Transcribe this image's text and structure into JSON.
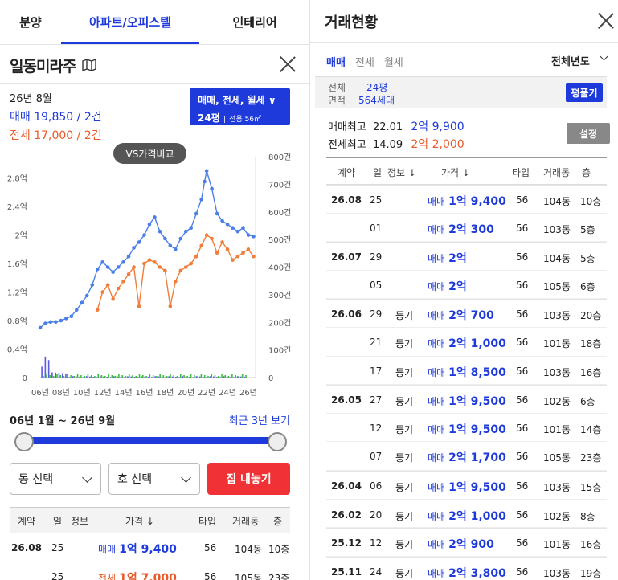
{
  "tabs": [
    "분양",
    "아파트/오피스텔",
    "인테리어"
  ],
  "complex": {
    "name": "일동미라주",
    "icon": "map-icon"
  },
  "summary": {
    "month": "26년 8월",
    "sale": "매매 19,850 / 2건",
    "jeonse": "전세 17,000 / 2건"
  },
  "filter": {
    "types": "매매, 전세, 월세",
    "size": "24평",
    "exclusive": "전용 56㎡"
  },
  "vs_button": "VS가격비교",
  "chart_data": {
    "type": "line",
    "x_ticks": [
      "06년",
      "08년",
      "10년",
      "12년",
      "14년",
      "16년",
      "18년",
      "20년",
      "22년",
      "24년",
      "26년"
    ],
    "y_left_ticks": [
      "0",
      "0.4억",
      "0.8억",
      "1.2억",
      "1.6억",
      "2억",
      "2.4억",
      "2.8억"
    ],
    "y_right_ticks": [
      "0",
      "100건",
      "200건",
      "300건",
      "400건",
      "500건",
      "600건",
      "700건",
      "800건"
    ],
    "ylim_left": [
      0,
      3.1
    ],
    "ylim_right": [
      0,
      800
    ],
    "colors": {
      "sale": "#4a7fe8",
      "jeonse": "#f07d3a",
      "volume_sale": "#5a5ae6",
      "volume_jeonse": "#3cc03c"
    },
    "series": [
      {
        "key": "sale",
        "x": [
          2006.0,
          2006.5,
          2007.0,
          2007.5,
          2008.0,
          2008.5,
          2009.0,
          2009.5,
          2010.0,
          2010.5,
          2011.0,
          2011.5,
          2012.0,
          2012.5,
          2013.0,
          2013.5,
          2014.0,
          2014.5,
          2015.0,
          2015.5,
          2016.0,
          2016.5,
          2017.0,
          2017.5,
          2018.0,
          2018.5,
          2019.0,
          2019.5,
          2020.0,
          2020.5,
          2021.0,
          2021.5,
          2021.8,
          2022.0,
          2022.5,
          2023.0,
          2023.5,
          2024.0,
          2024.5,
          2025.0,
          2025.5,
          2026.0,
          2026.5
        ],
        "y": [
          0.7,
          0.76,
          0.78,
          0.78,
          0.8,
          0.83,
          0.86,
          0.95,
          1.05,
          1.15,
          1.3,
          1.52,
          1.62,
          1.55,
          1.48,
          1.55,
          1.62,
          1.7,
          1.82,
          1.9,
          2.0,
          2.15,
          2.25,
          2.05,
          1.95,
          1.85,
          1.8,
          1.95,
          2.05,
          2.1,
          2.3,
          2.5,
          2.75,
          2.9,
          2.65,
          2.3,
          2.2,
          2.15,
          2.1,
          2.05,
          2.1,
          2.0,
          1.98
        ]
      },
      {
        "key": "jeonse",
        "x": [
          2011.5,
          2012.0,
          2012.5,
          2013.0,
          2013.5,
          2014.0,
          2014.5,
          2015.0,
          2015.5,
          2016.0,
          2016.5,
          2017.0,
          2017.5,
          2018.0,
          2018.5,
          2019.0,
          2019.5,
          2020.0,
          2020.5,
          2021.0,
          2021.5,
          2022.0,
          2022.5,
          2023.0,
          2023.5,
          2024.0,
          2024.5,
          2025.0,
          2025.5,
          2026.0,
          2026.5
        ],
        "y": [
          0.95,
          1.2,
          1.3,
          1.1,
          1.25,
          1.35,
          1.45,
          1.55,
          1.0,
          1.6,
          1.65,
          1.62,
          1.55,
          1.5,
          1.0,
          1.35,
          1.5,
          1.55,
          1.6,
          1.7,
          1.85,
          2.0,
          1.95,
          1.75,
          1.9,
          1.8,
          1.65,
          1.7,
          1.75,
          1.8,
          1.7
        ]
      }
    ]
  },
  "range": {
    "label": "06년 1월 ~ 26년 9월",
    "recent": "최근 3년 보기"
  },
  "selects": {
    "dong": "동 선택",
    "ho": "호 선택"
  },
  "listing_button": "집 내놓기",
  "table_headers": {
    "contract": "계약",
    "day": "일",
    "info": "정보",
    "price": "가격 ↓",
    "type": "타입",
    "dong": "거래동",
    "floor": "층"
  },
  "left_rows": [
    {
      "contract": "26.08",
      "day": "25",
      "info": "",
      "kind": "매매",
      "price": "1억 9,400",
      "type": "56",
      "dong": "104동",
      "floor": "10층"
    },
    {
      "contract": "",
      "day": "25",
      "info": "",
      "kind": "전세",
      "price": "1억 7,000",
      "type": "56",
      "dong": "105동",
      "floor": "23층"
    }
  ],
  "right": {
    "title": "거래현황",
    "tabs": [
      "매매",
      "전세",
      "월세"
    ],
    "year_filter": "전체년도",
    "summary": {
      "label1": "전체",
      "label2": "면적",
      "size": "24평",
      "households": "564세대",
      "button": "평풀기"
    },
    "highs": [
      {
        "label": "매매최고",
        "date": "22.01",
        "price": "2억 9,900"
      },
      {
        "label": "전세최고",
        "date": "14.09",
        "price": "2억 2,000"
      }
    ],
    "settings_button": "설정",
    "rows": [
      {
        "contract": "26.08",
        "day": "25",
        "info": "",
        "kind": "매매",
        "price": "1억 9,400",
        "type": "56",
        "dong": "104동",
        "floor": "10층"
      },
      {
        "contract": "",
        "day": "01",
        "info": "",
        "kind": "매매",
        "price": "2억 300",
        "type": "56",
        "dong": "103동",
        "floor": "5층"
      },
      {
        "contract": "26.07",
        "day": "29",
        "info": "",
        "kind": "매매",
        "price": "2억",
        "type": "56",
        "dong": "104동",
        "floor": "5층"
      },
      {
        "contract": "",
        "day": "05",
        "info": "",
        "kind": "매매",
        "price": "2억",
        "type": "56",
        "dong": "105동",
        "floor": "6층"
      },
      {
        "contract": "26.06",
        "day": "29",
        "info": "등기",
        "kind": "매매",
        "price": "2억 700",
        "type": "56",
        "dong": "103동",
        "floor": "20층"
      },
      {
        "contract": "",
        "day": "21",
        "info": "등기",
        "kind": "매매",
        "price": "2억 1,000",
        "type": "56",
        "dong": "101동",
        "floor": "18층"
      },
      {
        "contract": "",
        "day": "17",
        "info": "등기",
        "kind": "매매",
        "price": "1억 8,500",
        "type": "56",
        "dong": "103동",
        "floor": "16층"
      },
      {
        "contract": "26.05",
        "day": "27",
        "info": "등기",
        "kind": "매매",
        "price": "1억 9,500",
        "type": "56",
        "dong": "102동",
        "floor": "6층"
      },
      {
        "contract": "",
        "day": "12",
        "info": "등기",
        "kind": "매매",
        "price": "1억 9,500",
        "type": "56",
        "dong": "101동",
        "floor": "14층"
      },
      {
        "contract": "",
        "day": "07",
        "info": "등기",
        "kind": "매매",
        "price": "2억 1,700",
        "type": "56",
        "dong": "105동",
        "floor": "23층"
      },
      {
        "contract": "26.04",
        "day": "06",
        "info": "등기",
        "kind": "매매",
        "price": "1억 9,500",
        "type": "56",
        "dong": "103동",
        "floor": "15층"
      },
      {
        "contract": "26.02",
        "day": "20",
        "info": "등기",
        "kind": "매매",
        "price": "2억 1,000",
        "type": "56",
        "dong": "102동",
        "floor": "8층"
      },
      {
        "contract": "25.12",
        "day": "12",
        "info": "등기",
        "kind": "매매",
        "price": "2억 900",
        "type": "56",
        "dong": "101동",
        "floor": "16층"
      },
      {
        "contract": "25.11",
        "day": "24",
        "info": "등기",
        "kind": "매매",
        "price": "2억 3,800",
        "type": "56",
        "dong": "103동",
        "floor": "19층"
      }
    ]
  }
}
